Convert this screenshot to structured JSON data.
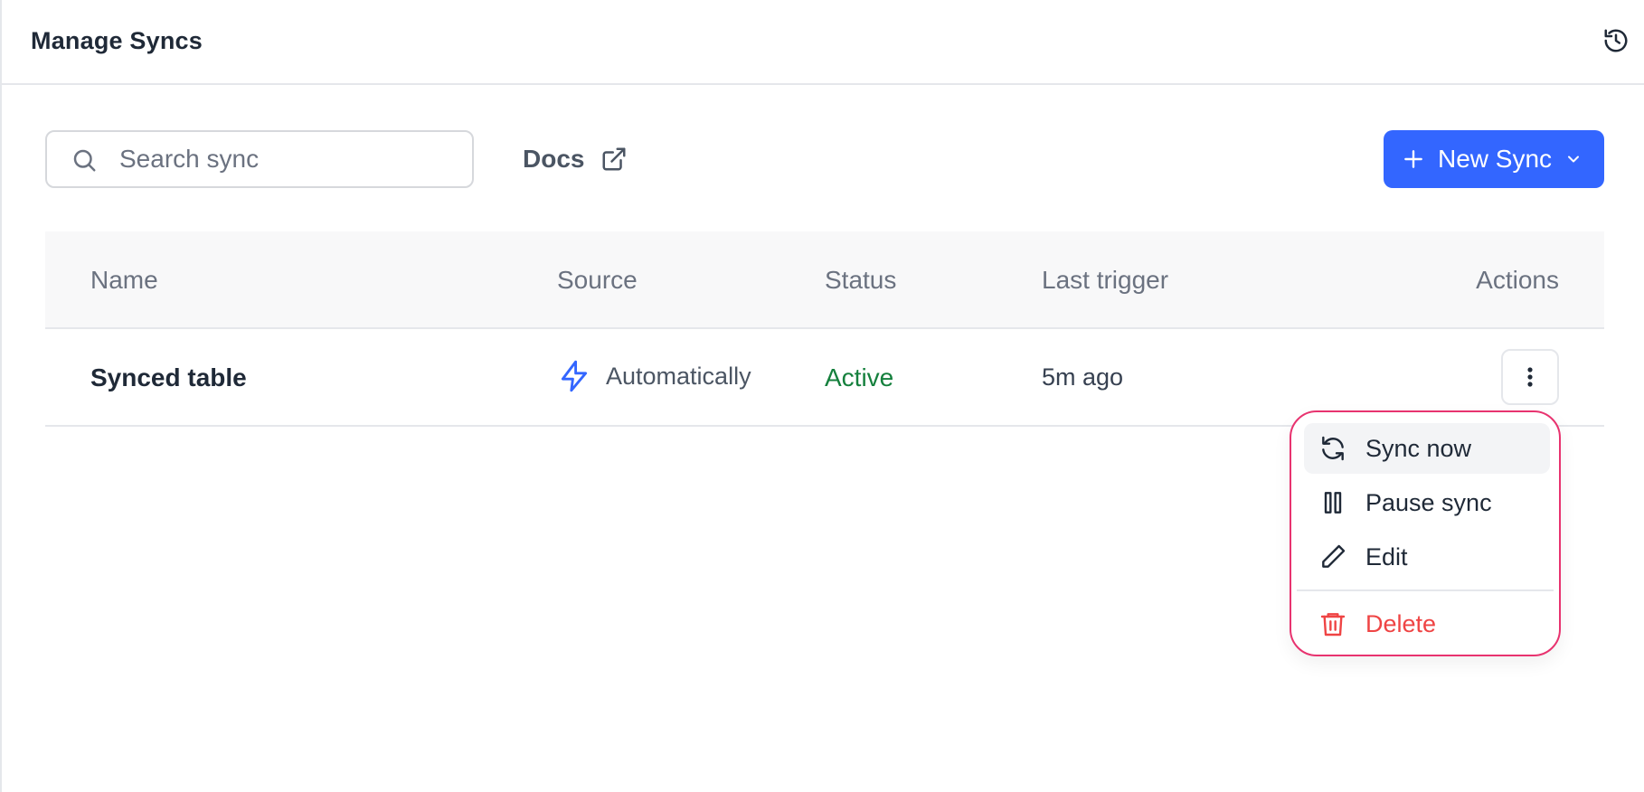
{
  "header": {
    "title": "Manage Syncs",
    "history_icon": "history-icon"
  },
  "toolbar": {
    "search_placeholder": "Search sync",
    "search_value": "",
    "docs_label": "Docs",
    "new_sync_label": "New Sync"
  },
  "table": {
    "columns": [
      "Name",
      "Source",
      "Status",
      "Last trigger",
      "Actions"
    ],
    "rows": [
      {
        "name": "Synced table",
        "source": "Automatically",
        "status": "Active",
        "last_trigger": "5m ago"
      }
    ]
  },
  "menu": {
    "items": [
      {
        "label": "Sync now",
        "icon": "refresh-icon"
      },
      {
        "label": "Pause sync",
        "icon": "pause-icon"
      },
      {
        "label": "Edit",
        "icon": "pencil-icon"
      },
      {
        "label": "Delete",
        "icon": "trash-icon"
      }
    ]
  },
  "colors": {
    "accent": "#3366ff",
    "status_active": "#15803d",
    "danger": "#ef4444",
    "menu_outline": "#e8336f"
  }
}
